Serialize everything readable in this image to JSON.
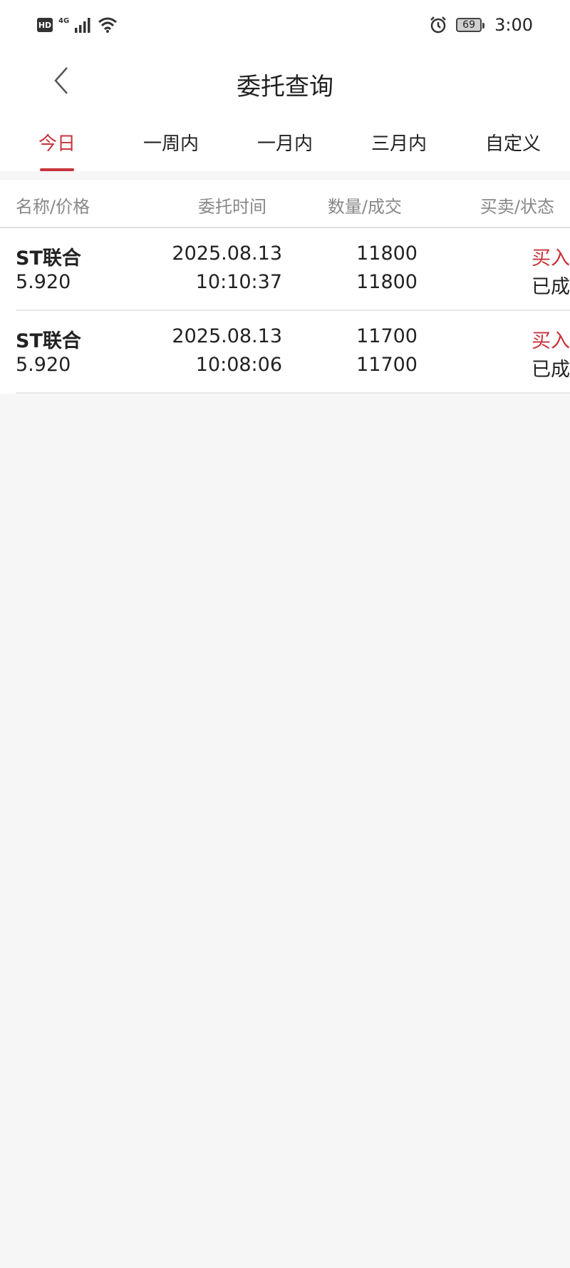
{
  "status_bar": {
    "hd": "HD",
    "network": "4G",
    "battery": "69",
    "time": "3:00"
  },
  "nav": {
    "title": "委托查询"
  },
  "tabs": [
    {
      "label": "今日",
      "active": true
    },
    {
      "label": "一周内",
      "active": false
    },
    {
      "label": "一月内",
      "active": false
    },
    {
      "label": "三月内",
      "active": false
    },
    {
      "label": "自定义",
      "active": false
    }
  ],
  "table": {
    "headers": {
      "name_price": "名称/价格",
      "time": "委托时间",
      "qty_fill": "数量/成交",
      "side_status": "买卖/状态"
    },
    "rows": [
      {
        "name": "ST联合",
        "price": "5.920",
        "date": "2025.08.13",
        "time": "10:10:37",
        "quantity": "11800",
        "filled": "11800",
        "side": "买入",
        "status": "已成"
      },
      {
        "name": "ST联合",
        "price": "5.920",
        "date": "2025.08.13",
        "time": "10:08:06",
        "quantity": "11700",
        "filled": "11700",
        "side": "买入",
        "status": "已成"
      }
    ]
  },
  "colors": {
    "accent": "#c8333b",
    "background": "#f6f6f6"
  }
}
